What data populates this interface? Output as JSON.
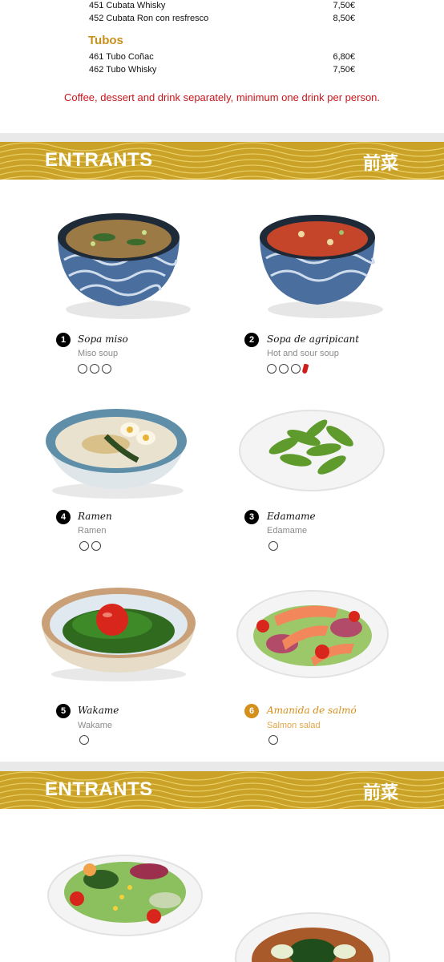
{
  "drinks_top": [
    {
      "name": "451 Cubata Whisky",
      "price": "7,50€"
    },
    {
      "name": "452 Cubata Ron con resfresco",
      "price": "8,50€"
    }
  ],
  "tubos": {
    "title": "Tubos",
    "items": [
      {
        "name": "461 Tubo Coñac",
        "price": "6,80€"
      },
      {
        "name": "462 Tubo Whisky",
        "price": "7,50€"
      }
    ]
  },
  "note": "Coffee, dessert and drink separately, minimum one drink per person.",
  "section1": {
    "title": "ENTRANTS",
    "kanji": "前菜"
  },
  "section2": {
    "title": "ENTRANTS",
    "kanji": "前菜"
  },
  "dishes": [
    {
      "number": "1",
      "name": "Sopa miso",
      "subtitle": "Miso soup",
      "icons": [
        "soy-icon",
        "shellfish-icon",
        "fish-icon"
      ],
      "highlight": false
    },
    {
      "number": "2",
      "name": "Sopa de agripicant",
      "subtitle": "Hot and sour soup",
      "icons": [
        "soy-icon",
        "egg-icon",
        "fish-icon",
        "chili-icon"
      ],
      "highlight": false
    },
    {
      "number": "4",
      "name": "Ramen",
      "subtitle": "Ramen",
      "icons": [
        "gluten-icon",
        "egg-icon"
      ],
      "highlight": false
    },
    {
      "number": "3",
      "name": "Edamame",
      "subtitle": "Edamame",
      "icons": [
        "fish-icon"
      ],
      "highlight": false
    },
    {
      "number": "5",
      "name": "Wakame",
      "subtitle": "Wakame",
      "icons": [
        "fish-icon"
      ],
      "highlight": false
    },
    {
      "number": "6",
      "name": "Amanida de salmó",
      "subtitle": "Salmon salad",
      "icons": [
        "shellfish-icon"
      ],
      "highlight": true
    }
  ],
  "colors": {
    "accent": "#d48f1c",
    "banner": "#c9a227",
    "note": "#c8151b"
  }
}
